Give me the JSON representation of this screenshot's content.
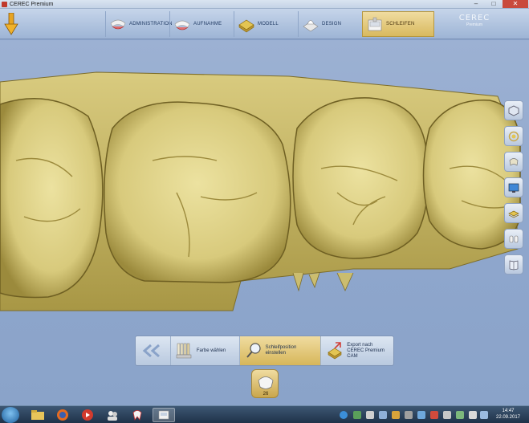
{
  "window": {
    "title": "CEREC Premium",
    "minimize": "–",
    "maximize": "□",
    "close": "✕"
  },
  "toolbar": {
    "back_icon": "back-arrow-icon",
    "steps": [
      {
        "label": "ADMINISTRATION",
        "icon": "administration-icon",
        "active": false
      },
      {
        "label": "AUFNAHME",
        "icon": "acquisition-icon",
        "active": false
      },
      {
        "label": "MODELL",
        "icon": "model-icon",
        "active": false
      },
      {
        "label": "DESIGN",
        "icon": "design-icon",
        "active": false
      },
      {
        "label": "SCHLEIFEN",
        "icon": "milling-icon",
        "active": true
      }
    ],
    "brand": {
      "name": "CEREC",
      "edition": "Premium"
    }
  },
  "side_tools": [
    "view-cube-icon",
    "rotate-icon",
    "tooth-view-icon",
    "screen-icon",
    "layers-icon",
    "tooth-group-icon",
    "book-icon"
  ],
  "action_bar": {
    "back_icon": "double-chevron-left-icon",
    "items": [
      {
        "line1": "Farbe wählen",
        "line2": "",
        "line3": "",
        "icon": "shade-guide-icon"
      },
      {
        "line1": "Schleifposition",
        "line2": "einstellen",
        "line3": "",
        "icon": "magnifier-icon"
      },
      {
        "line1": "Export nach",
        "line2": "CEREC Premium",
        "line3": "CAM",
        "icon": "export-icon"
      }
    ]
  },
  "tooth_badge": {
    "number": "26"
  },
  "taskbar": {
    "clock_time": "14:47",
    "clock_date": "22.09.2017"
  },
  "colors": {
    "model": "#d7c97a",
    "model_shadow": "#8f7f36",
    "background": "#8aa3c9",
    "active_step": "#e8cf86"
  }
}
